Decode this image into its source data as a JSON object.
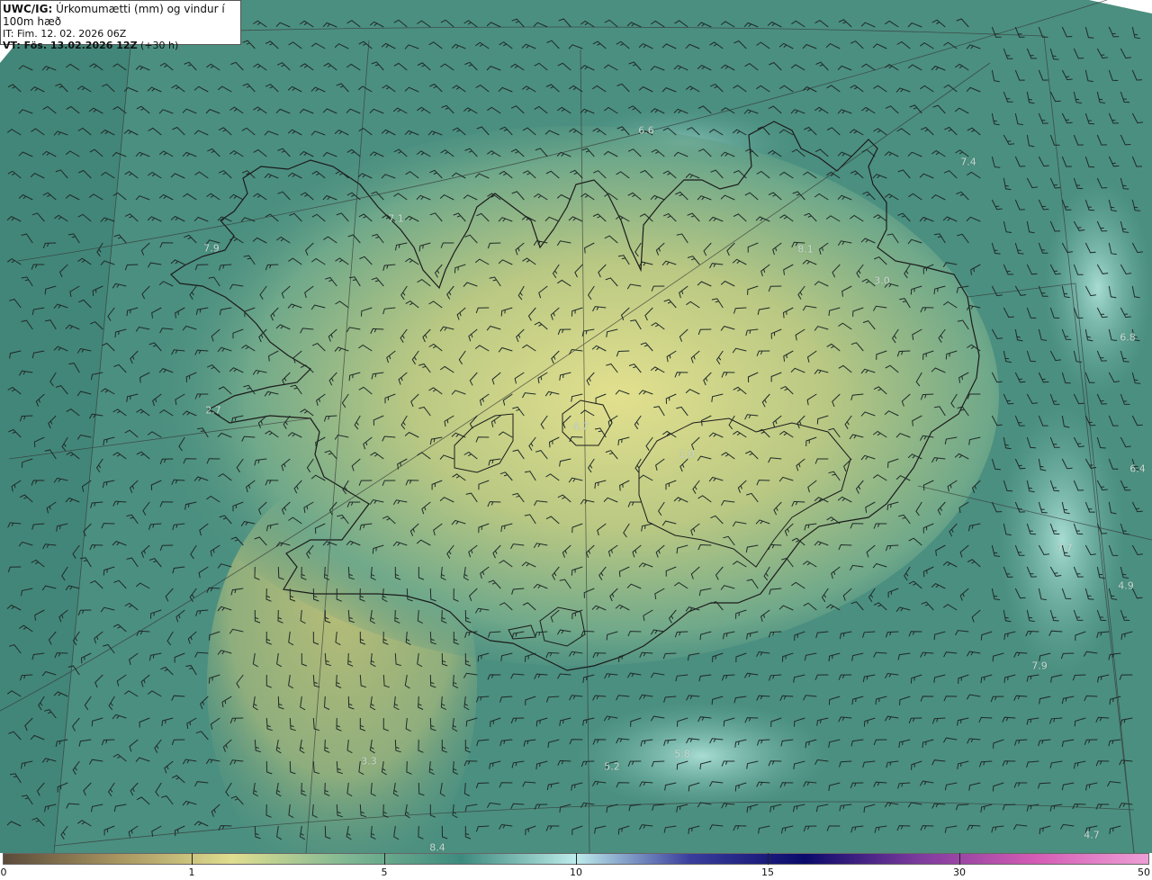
{
  "header": {
    "line1_prefix": "UWC/IG:",
    "line1_text": " Úrkomumætti (mm) og vindur í 100m hæð",
    "line2": "IT: Fim. 12. 02. 2026 06Z",
    "line3_prefix": "VT:",
    "line3_bold": " Fös. 13.02.2026 12Z",
    "line3_rest": " (+30 h)"
  },
  "value_labels": [
    "6.6",
    "7.4",
    "7.1",
    "7.9",
    "8.1",
    "3.0",
    "6.8",
    "2.7",
    "4.7",
    "1.0",
    "6.4",
    "7.7",
    "4.9",
    "7.9",
    "3.3",
    "5.2",
    "5.8",
    "4.7",
    "8.4"
  ],
  "colorbar": {
    "ticks": [
      "0",
      "1",
      "5",
      "10",
      "15",
      "30",
      "50"
    ],
    "colors": [
      "#5b4a3a",
      "#a89560",
      "#e0de90",
      "#7fb893",
      "#3d8a7e",
      "#bdeceb",
      "#3a3d9c",
      "#0a0a6a",
      "#7d3b9d",
      "#d35bb4",
      "#ee9fd6"
    ]
  }
}
